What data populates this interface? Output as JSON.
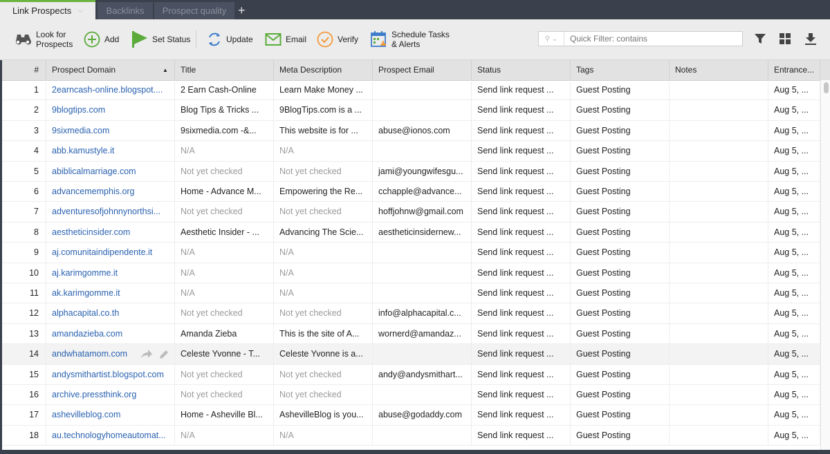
{
  "tabs": [
    {
      "label": "Link Prospects",
      "active": true
    },
    {
      "label": "Backlinks",
      "active": false
    },
    {
      "label": "Prospect quality",
      "active": false
    }
  ],
  "toolbar": {
    "look_for_prospects": "Look for Prospects",
    "look_line1": "Look for",
    "look_line2": "Prospects",
    "add": "Add",
    "set_status": "Set Status",
    "update": "Update",
    "email": "Email",
    "verify": "Verify",
    "schedule_line1": "Schedule Tasks",
    "schedule_line2": "& Alerts",
    "quick_filter_placeholder": "Quick Filter: contains"
  },
  "colors": {
    "accent_green": "#6cb33f",
    "link_blue": "#2a62b0",
    "verify_orange": "#f39a3c",
    "update_blue": "#3d7cc9"
  },
  "table": {
    "columns": [
      "#",
      "Prospect Domain",
      "Title",
      "Meta Description",
      "Prospect Email",
      "Status",
      "Tags",
      "Notes",
      "Entrance..."
    ],
    "sorted_column": "Prospect Domain",
    "sort_direction": "ascending",
    "rows": [
      {
        "n": "1",
        "domain": "2earncash-online.blogspot....",
        "title": "2 Earn Cash-Online",
        "meta": "Learn Make Money ...",
        "email": "",
        "status": "Send link request ...",
        "tags": "Guest Posting",
        "notes": "",
        "entrance": "Aug 5, ..."
      },
      {
        "n": "2",
        "domain": "9blogtips.com",
        "title": "Blog Tips & Tricks ...",
        "meta": "9BlogTips.com is a ...",
        "email": "",
        "status": "Send link request ...",
        "tags": "Guest Posting",
        "notes": "",
        "entrance": "Aug 5, ..."
      },
      {
        "n": "3",
        "domain": "9sixmedia.com",
        "title": "9sixmedia.com -&...",
        "meta": "This website is for ...",
        "email": "abuse@ionos.com",
        "status": "Send link request ...",
        "tags": "Guest Posting",
        "notes": "",
        "entrance": "Aug 5, ..."
      },
      {
        "n": "4",
        "domain": "abb.kamustyle.it",
        "title": "N/A",
        "meta": "N/A",
        "email": "",
        "status": "Send link request ...",
        "tags": "Guest Posting",
        "notes": "",
        "entrance": "Aug 5, ..."
      },
      {
        "n": "5",
        "domain": "abiblicalmarriage.com",
        "title": "Not yet checked",
        "meta": "Not yet checked",
        "email": "jami@youngwifesgu...",
        "status": "Send link request ...",
        "tags": "Guest Posting",
        "notes": "",
        "entrance": "Aug 5, ..."
      },
      {
        "n": "6",
        "domain": "advancememphis.org",
        "title": "Home - Advance M...",
        "meta": "Empowering the Re...",
        "email": "cchapple@advance...",
        "status": "Send link request ...",
        "tags": "Guest Posting",
        "notes": "",
        "entrance": "Aug 5, ..."
      },
      {
        "n": "7",
        "domain": "adventuresofjohnnynorthsi...",
        "title": "Not yet checked",
        "meta": "Not yet checked",
        "email": "hoffjohnw@gmail.com",
        "status": "Send link request ...",
        "tags": "Guest Posting",
        "notes": "",
        "entrance": "Aug 5, ..."
      },
      {
        "n": "8",
        "domain": "aestheticinsider.com",
        "title": "Aesthetic Insider - ...",
        "meta": "Advancing The Scie...",
        "email": "aestheticinsidernew...",
        "status": "Send link request ...",
        "tags": "Guest Posting",
        "notes": "",
        "entrance": "Aug 5, ..."
      },
      {
        "n": "9",
        "domain": "aj.comunitaindipendente.it",
        "title": "N/A",
        "meta": "N/A",
        "email": "",
        "status": "Send link request ...",
        "tags": "Guest Posting",
        "notes": "",
        "entrance": "Aug 5, ..."
      },
      {
        "n": "10",
        "domain": "aj.karimgomme.it",
        "title": "N/A",
        "meta": "N/A",
        "email": "",
        "status": "Send link request ...",
        "tags": "Guest Posting",
        "notes": "",
        "entrance": "Aug 5, ..."
      },
      {
        "n": "11",
        "domain": "ak.karimgomme.it",
        "title": "N/A",
        "meta": "N/A",
        "email": "",
        "status": "Send link request ...",
        "tags": "Guest Posting",
        "notes": "",
        "entrance": "Aug 5, ..."
      },
      {
        "n": "12",
        "domain": "alphacapital.co.th",
        "title": "Not yet checked",
        "meta": "Not yet checked",
        "email": "info@alphacapital.c...",
        "status": "Send link request ...",
        "tags": "Guest Posting",
        "notes": "",
        "entrance": "Aug 5, ..."
      },
      {
        "n": "13",
        "domain": "amandazieba.com",
        "title": "Amanda Zieba",
        "meta": "This is the site of A...",
        "email": "wornerd@amandaz...",
        "status": "Send link request ...",
        "tags": "Guest Posting",
        "notes": "",
        "entrance": "Aug 5, ..."
      },
      {
        "n": "14",
        "domain": "andwhatamom.com",
        "title": "Celeste Yvonne - T...",
        "meta": "Celeste Yvonne is a...",
        "email": "",
        "status": "Send link request ...",
        "tags": "Guest Posting",
        "notes": "",
        "entrance": "Aug 5, ...",
        "hover": true
      },
      {
        "n": "15",
        "domain": "andysmithartist.blogspot.com",
        "title": "Not yet checked",
        "meta": "Not yet checked",
        "email": "andy@andysmithart...",
        "status": "Send link request ...",
        "tags": "Guest Posting",
        "notes": "",
        "entrance": "Aug 5, ..."
      },
      {
        "n": "16",
        "domain": "archive.pressthink.org",
        "title": "Not yet checked",
        "meta": "Not yet checked",
        "email": "",
        "status": "Send link request ...",
        "tags": "Guest Posting",
        "notes": "",
        "entrance": "Aug 5, ..."
      },
      {
        "n": "17",
        "domain": "ashevilleblog.com",
        "title": "Home - Asheville Bl...",
        "meta": "AshevilleBlog is you...",
        "email": "abuse@godaddy.com",
        "status": "Send link request ...",
        "tags": "Guest Posting",
        "notes": "",
        "entrance": "Aug 5, ..."
      },
      {
        "n": "18",
        "domain": "au.technologyhomeautomat...",
        "title": "N/A",
        "meta": "N/A",
        "email": "",
        "status": "Send link request ...",
        "tags": "Guest Posting",
        "notes": "",
        "entrance": "Aug 5, ..."
      }
    ]
  }
}
